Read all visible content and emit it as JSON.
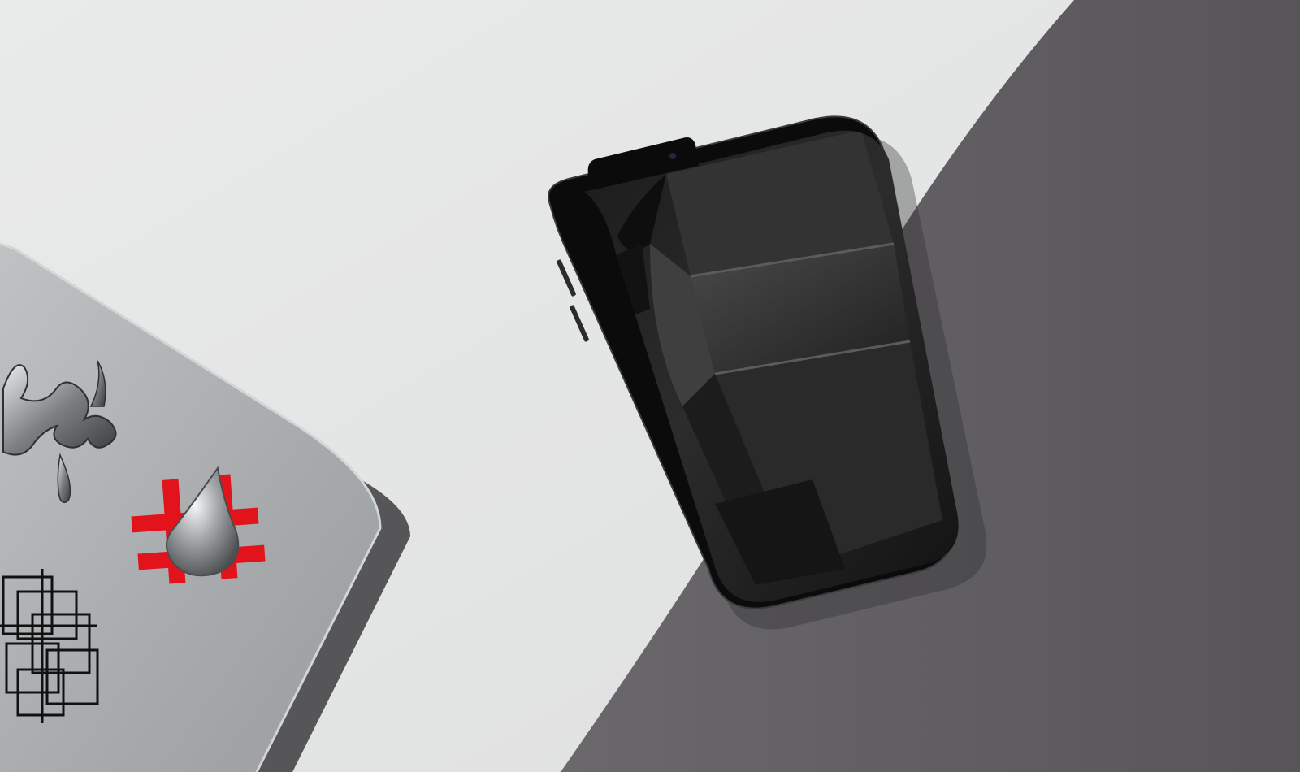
{
  "scene": {
    "description_visible_text": "",
    "objects": [
      {
        "name": "laptop-lid",
        "color": "#a9acae"
      },
      {
        "name": "smartphone",
        "color": "#0b0b0c"
      },
      {
        "name": "desk-surface-light",
        "color": "#e4e5e5"
      },
      {
        "name": "desk-shadow",
        "color": "#5d5b5e"
      }
    ],
    "stickers": [
      {
        "name": "chrome-liquid-sticker",
        "color": "#8f9294"
      },
      {
        "name": "red-hash-sticker",
        "color": "#e3131b"
      },
      {
        "name": "chrome-drop-sticker",
        "color": "#b9bcbe"
      },
      {
        "name": "line-squares-sticker",
        "color": "#111111"
      }
    ]
  }
}
